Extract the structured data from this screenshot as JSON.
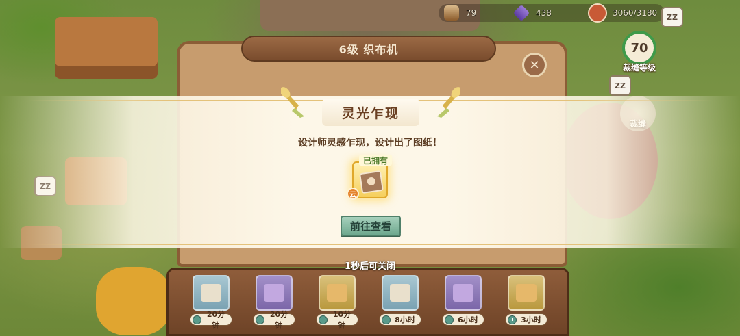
{
  "topbar": {
    "wood": "79",
    "gems": "438",
    "capacity": "3060/3180",
    "sleep_badge": "ZZ"
  },
  "sidebar": {
    "tailor_level": "70",
    "tailor_level_label": "裁缝等级",
    "sew_label": "裁缝"
  },
  "loom": {
    "title": "6级 织布机",
    "close_icon": "✕"
  },
  "popup": {
    "title": "灵光乍现",
    "description": "设计师灵感乍现，设计出了图纸！",
    "owned_tag": "已拥有",
    "badge": "云",
    "view_button": "前往查看",
    "close_hint": "1秒后可关闭"
  },
  "queue": [
    {
      "time": "20分钟",
      "tone": "blue"
    },
    {
      "time": "20分钟",
      "tone": "purple"
    },
    {
      "time": "10分钟",
      "tone": "gold"
    },
    {
      "time": "8小时",
      "tone": "blue"
    },
    {
      "time": "6小时",
      "tone": "purple"
    },
    {
      "time": "3小时",
      "tone": "gold"
    }
  ],
  "colors": {
    "accent_green": "#6ea88e",
    "wood_brown": "#8f5d3b",
    "gold": "#e4c27a"
  }
}
